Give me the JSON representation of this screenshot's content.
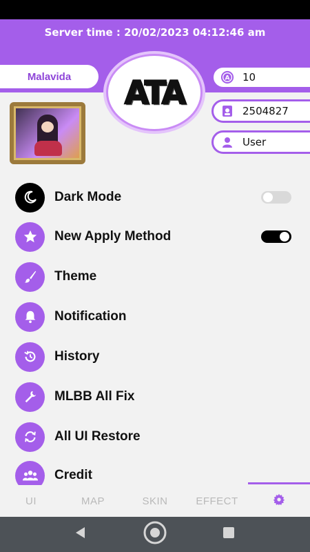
{
  "header": {
    "server_time_label": "Server time :",
    "server_time": "20/02/2023 04:12:46 am"
  },
  "profile": {
    "name": "Malavida",
    "logo_text": "ATA",
    "coins": "10",
    "user_id": "2504827",
    "role": "User"
  },
  "menu": [
    {
      "label": "Dark Mode",
      "icon": "moon-icon",
      "toggle": false
    },
    {
      "label": "New Apply Method",
      "icon": "star-icon",
      "toggle": true
    },
    {
      "label": "Theme",
      "icon": "brush-icon"
    },
    {
      "label": "Notification",
      "icon": "bell-icon"
    },
    {
      "label": "History",
      "icon": "history-icon"
    },
    {
      "label": "MLBB All Fix",
      "icon": "wrench-icon"
    },
    {
      "label": "All UI Restore",
      "icon": "refresh-icon"
    },
    {
      "label": "Credit",
      "icon": "users-icon"
    }
  ],
  "tabs": [
    {
      "label": "UI"
    },
    {
      "label": "MAP"
    },
    {
      "label": "SKIN"
    },
    {
      "label": "EFFECT"
    },
    {
      "label": "",
      "icon": "gear-icon",
      "active": true
    }
  ],
  "colors": {
    "accent": "#a45eea",
    "tab_inactive": "#b9b9b9",
    "navbar": "#4d5257"
  }
}
